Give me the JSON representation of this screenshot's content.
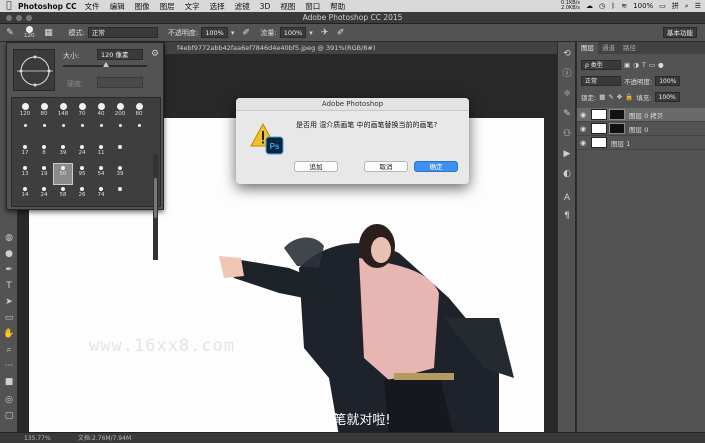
{
  "menubar": {
    "app_name": "Photoshop CC",
    "items": [
      "文件",
      "编辑",
      "图像",
      "图层",
      "文字",
      "选择",
      "滤镜",
      "3D",
      "视图",
      "窗口",
      "帮助"
    ],
    "net_up": "0.1KB/s",
    "net_down": "2.0KB/s",
    "battery": "100%",
    "input_method": "拼"
  },
  "window": {
    "title": "Adobe Photoshop CC 2015"
  },
  "options_bar": {
    "brush_size": "120",
    "mode_label": "模式:",
    "mode_value": "正常",
    "opacity_label": "不透明度:",
    "opacity_value": "100%",
    "flow_label": "流量:",
    "flow_value": "100%",
    "workspace": "基本功能"
  },
  "document_tab": {
    "label": "f4ebf9772abb42faa6ef7846d4e40bf5.jpeg @ 391%(RGB/8#)"
  },
  "brush_picker": {
    "size_label": "大小:",
    "size_value": "120 像素",
    "hardness_label": "硬度:",
    "presets_row1": [
      "120",
      "80",
      "148",
      "70",
      "40",
      "200",
      "80"
    ],
    "presets_row2": [
      "",
      "",
      "",
      "",
      "",
      "",
      ""
    ],
    "presets_row3": [
      "17",
      "8",
      "39",
      "24",
      "11",
      ""
    ],
    "presets_row4": [
      "13",
      "19",
      "50",
      "95",
      "54",
      "39"
    ],
    "presets_row5": [
      "14",
      "24",
      "58",
      "26",
      "74",
      ""
    ]
  },
  "dialog": {
    "title": "Adobe Photoshop",
    "message": "是否用 湿介质画笔 中的画笔替换当前的画笔?",
    "append_label": "追加",
    "cancel_label": "取消",
    "ok_label": "确定",
    "ps_badge": "Ps"
  },
  "canvas": {
    "watermark": "www.16xx8.com",
    "subtitle": "墨迹效果就选湿介质画笔就对啦!"
  },
  "layers_panel": {
    "tabs": [
      "图层",
      "通道",
      "路径"
    ],
    "filter_label": "ρ 类型",
    "blend_mode": "正常",
    "opacity_label": "不透明度:",
    "opacity_value": "100%",
    "lock_label": "锁定:",
    "fill_label": "填充:",
    "fill_value": "100%",
    "layers": [
      {
        "name": "图层 0 拷贝",
        "selected": true
      },
      {
        "name": "图层 0",
        "selected": false
      },
      {
        "name": "图层 1",
        "selected": false
      }
    ]
  },
  "status_bar": {
    "zoom": "135.77%",
    "doc_size": "文档:2.76M/7.94M"
  },
  "colors": {
    "accent": "#3d8ff0",
    "panel": "#535353",
    "dark": "#282828"
  }
}
